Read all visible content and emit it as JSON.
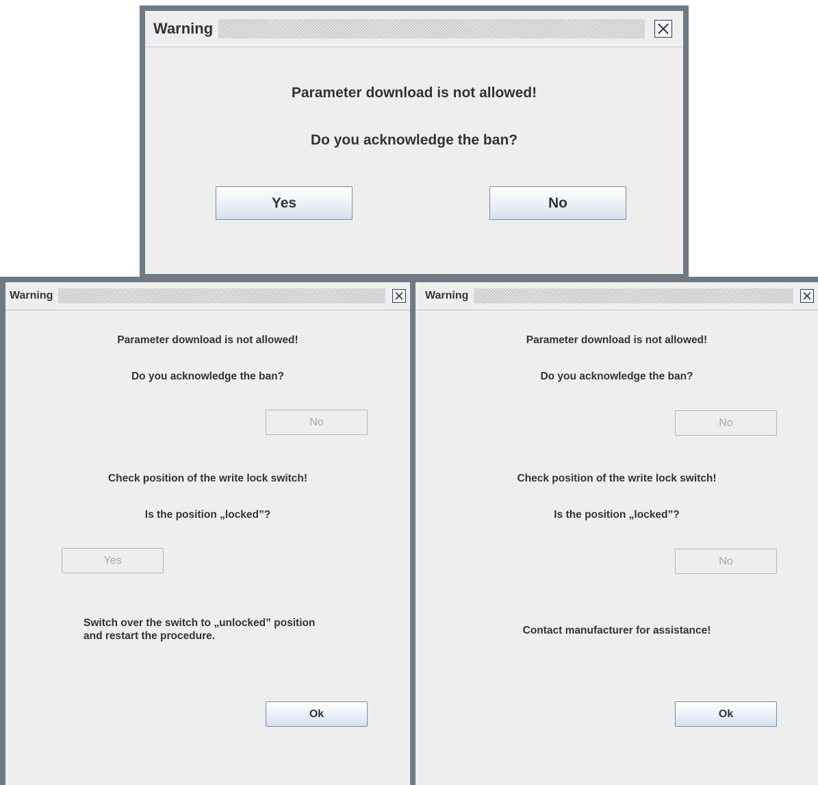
{
  "dialogs": {
    "top": {
      "title": "Warning",
      "message1": "Parameter download is not allowed!",
      "message2": "Do you acknowledge the ban?",
      "yes_label": "Yes",
      "no_label": "No"
    },
    "left": {
      "title": "Warning",
      "message1": "Parameter download is not allowed!",
      "message2": "Do you acknowledge the ban?",
      "no_label": "No",
      "message3": "Check position of the write lock switch!",
      "message4": "Is the position „locked”?",
      "yes_label": "Yes",
      "instruction": "Switch over the switch to „unlocked” position\nand restart the procedure.",
      "ok_label": "Ok"
    },
    "right": {
      "title": "Warning",
      "message1": "Parameter download is not allowed!",
      "message2": "Do you acknowledge the ban?",
      "no_label_1": "No",
      "message3": "Check position of the write lock switch!",
      "message4": "Is the position „locked”?",
      "no_label_2": "No",
      "instruction": "Contact manufacturer for assistance!",
      "ok_label": "Ok"
    }
  },
  "icons": {
    "close": "close-x-icon"
  },
  "colors": {
    "frame": "#6f7a85",
    "dialog_bg": "#eeeeee",
    "button_gradient_bottom": "#d5e1ef",
    "disabled_text": "#a8a8a8"
  }
}
